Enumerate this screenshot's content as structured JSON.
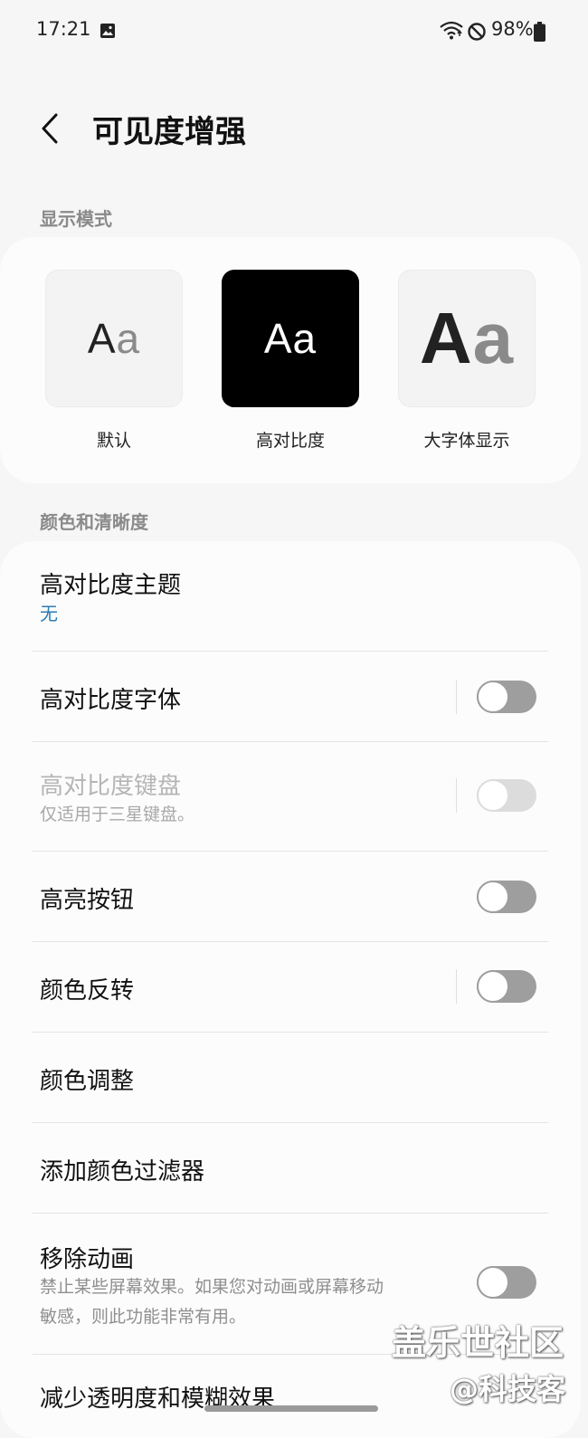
{
  "status_bar": {
    "time": "17:21",
    "battery": "98%",
    "icons": [
      "gallery-icon",
      "wifi-icon",
      "do-not-disturb-icon",
      "battery-icon"
    ]
  },
  "header": {
    "back_icon": "chevron-left-icon",
    "title": "可见度增强"
  },
  "display_mode": {
    "section_label": "显示模式",
    "options": [
      {
        "sample": "Aa",
        "sample_big": "A",
        "sample_small": "a",
        "label": "默认"
      },
      {
        "sample_big": "A",
        "sample_small": "a",
        "label": "高对比度"
      },
      {
        "sample_big": "A",
        "sample_small": "a",
        "label": "大字体显示"
      }
    ],
    "selected": "高对比度"
  },
  "color_clarity": {
    "section_label": "颜色和清晰度",
    "items": [
      {
        "title": "高对比度主题",
        "subtitle": "无"
      },
      {
        "title": "高对比度字体",
        "toggle": "off"
      },
      {
        "title": "高对比度键盘",
        "subtitle": "仅适用于三星键盘。",
        "toggle": "off",
        "disabled": true
      },
      {
        "title": "高亮按钮",
        "toggle": "off"
      },
      {
        "title": "颜色反转",
        "toggle": "off"
      },
      {
        "title": "颜色调整"
      },
      {
        "title": "添加颜色过滤器"
      },
      {
        "title": "移除动画",
        "subtitle_line1": "禁止某些屏幕效果。如果您对动画或屏幕移动",
        "subtitle_line2": "敏感，则此功能非常有用。",
        "toggle": "off"
      },
      {
        "title": "减少透明度和模糊效果"
      }
    ]
  },
  "watermark": {
    "line1": "盖乐世社区",
    "line2": "@科技客"
  },
  "colors": {
    "background": "#f6f6f6",
    "card": "#fcfcfc",
    "accent": "#2c7cb5",
    "toggle_off": "#9e9e9e"
  }
}
